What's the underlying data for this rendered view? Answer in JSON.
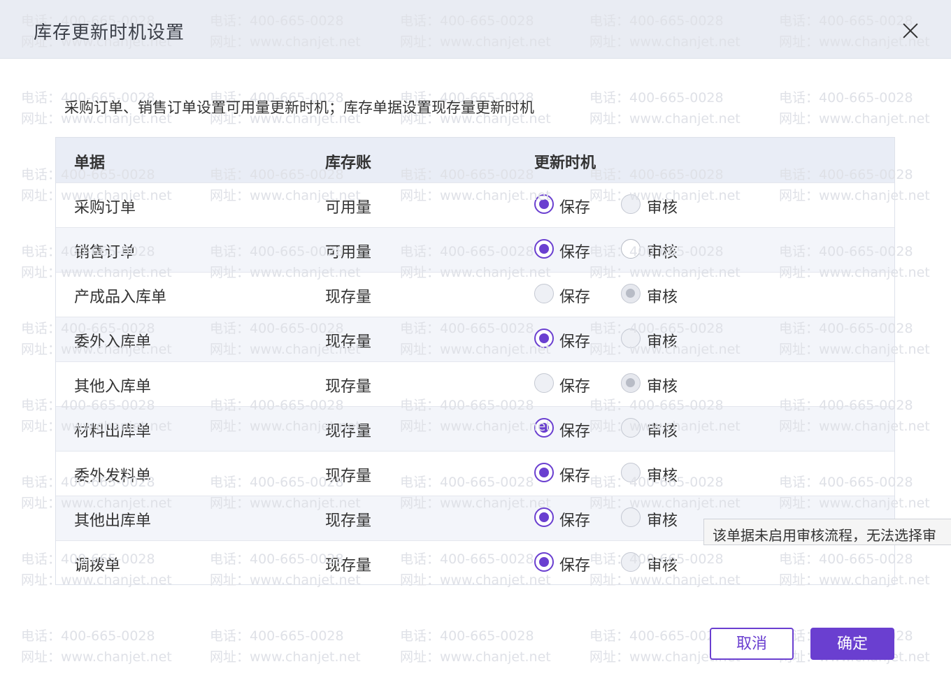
{
  "dialog": {
    "title": "库存更新时机设置",
    "description": "采购订单、销售订单设置可用量更新时机；库存单据设置现存量更新时机"
  },
  "table": {
    "headers": [
      "单据",
      "库存账",
      "更新时机"
    ],
    "rows": [
      {
        "doc": "采购订单",
        "ledger": "可用量",
        "save": "保存",
        "audit": "审核",
        "selected": "保存"
      },
      {
        "doc": "销售订单",
        "ledger": "可用量",
        "save": "保存",
        "audit": "审核",
        "selected": "保存"
      },
      {
        "doc": "产成品入库单",
        "ledger": "现存量",
        "save": "保存",
        "audit": "审核",
        "selected": "审核"
      },
      {
        "doc": "委外入库单",
        "ledger": "现存量",
        "save": "保存",
        "audit": "审核",
        "selected": "保存"
      },
      {
        "doc": "其他入库单",
        "ledger": "现存量",
        "save": "保存",
        "audit": "审核",
        "selected": "审核"
      },
      {
        "doc": "材料出库单",
        "ledger": "现存量",
        "save": "保存",
        "audit": "审核",
        "selected": "保存"
      },
      {
        "doc": "委外发料单",
        "ledger": "现存量",
        "save": "保存",
        "audit": "审核",
        "selected": "保存"
      },
      {
        "doc": "其他出库单",
        "ledger": "现存量",
        "save": "保存",
        "audit": "审核",
        "selected": "保存"
      },
      {
        "doc": "调拨单",
        "ledger": "现存量",
        "save": "保存",
        "audit": "审核",
        "selected": "保存"
      }
    ]
  },
  "tooltip": "该单据未启用审核流程，无法选择审",
  "buttons": {
    "cancel": "取消",
    "ok": "确定"
  },
  "watermark": {
    "phone": "电话：400-665-0028",
    "site": "网址：www.chanjet.net"
  },
  "colors": {
    "accent": "#6a3fd0",
    "header_bg": "#e9ecf3"
  }
}
